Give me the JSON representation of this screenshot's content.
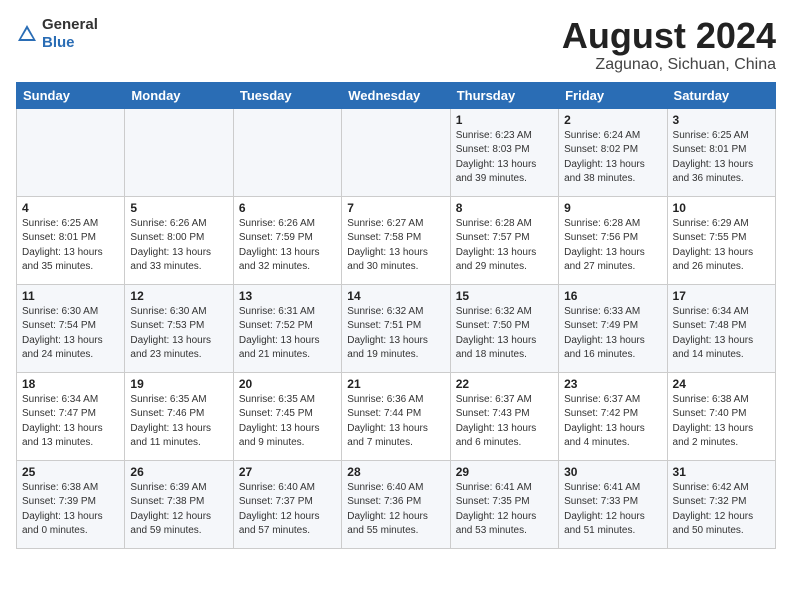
{
  "header": {
    "logo_general": "General",
    "logo_blue": "Blue",
    "month_title": "August 2024",
    "location": "Zagunao, Sichuan, China"
  },
  "weekdays": [
    "Sunday",
    "Monday",
    "Tuesday",
    "Wednesday",
    "Thursday",
    "Friday",
    "Saturday"
  ],
  "weeks": [
    [
      {
        "day": "",
        "info": ""
      },
      {
        "day": "",
        "info": ""
      },
      {
        "day": "",
        "info": ""
      },
      {
        "day": "",
        "info": ""
      },
      {
        "day": "1",
        "info": "Sunrise: 6:23 AM\nSunset: 8:03 PM\nDaylight: 13 hours\nand 39 minutes."
      },
      {
        "day": "2",
        "info": "Sunrise: 6:24 AM\nSunset: 8:02 PM\nDaylight: 13 hours\nand 38 minutes."
      },
      {
        "day": "3",
        "info": "Sunrise: 6:25 AM\nSunset: 8:01 PM\nDaylight: 13 hours\nand 36 minutes."
      }
    ],
    [
      {
        "day": "4",
        "info": "Sunrise: 6:25 AM\nSunset: 8:01 PM\nDaylight: 13 hours\nand 35 minutes."
      },
      {
        "day": "5",
        "info": "Sunrise: 6:26 AM\nSunset: 8:00 PM\nDaylight: 13 hours\nand 33 minutes."
      },
      {
        "day": "6",
        "info": "Sunrise: 6:26 AM\nSunset: 7:59 PM\nDaylight: 13 hours\nand 32 minutes."
      },
      {
        "day": "7",
        "info": "Sunrise: 6:27 AM\nSunset: 7:58 PM\nDaylight: 13 hours\nand 30 minutes."
      },
      {
        "day": "8",
        "info": "Sunrise: 6:28 AM\nSunset: 7:57 PM\nDaylight: 13 hours\nand 29 minutes."
      },
      {
        "day": "9",
        "info": "Sunrise: 6:28 AM\nSunset: 7:56 PM\nDaylight: 13 hours\nand 27 minutes."
      },
      {
        "day": "10",
        "info": "Sunrise: 6:29 AM\nSunset: 7:55 PM\nDaylight: 13 hours\nand 26 minutes."
      }
    ],
    [
      {
        "day": "11",
        "info": "Sunrise: 6:30 AM\nSunset: 7:54 PM\nDaylight: 13 hours\nand 24 minutes."
      },
      {
        "day": "12",
        "info": "Sunrise: 6:30 AM\nSunset: 7:53 PM\nDaylight: 13 hours\nand 23 minutes."
      },
      {
        "day": "13",
        "info": "Sunrise: 6:31 AM\nSunset: 7:52 PM\nDaylight: 13 hours\nand 21 minutes."
      },
      {
        "day": "14",
        "info": "Sunrise: 6:32 AM\nSunset: 7:51 PM\nDaylight: 13 hours\nand 19 minutes."
      },
      {
        "day": "15",
        "info": "Sunrise: 6:32 AM\nSunset: 7:50 PM\nDaylight: 13 hours\nand 18 minutes."
      },
      {
        "day": "16",
        "info": "Sunrise: 6:33 AM\nSunset: 7:49 PM\nDaylight: 13 hours\nand 16 minutes."
      },
      {
        "day": "17",
        "info": "Sunrise: 6:34 AM\nSunset: 7:48 PM\nDaylight: 13 hours\nand 14 minutes."
      }
    ],
    [
      {
        "day": "18",
        "info": "Sunrise: 6:34 AM\nSunset: 7:47 PM\nDaylight: 13 hours\nand 13 minutes."
      },
      {
        "day": "19",
        "info": "Sunrise: 6:35 AM\nSunset: 7:46 PM\nDaylight: 13 hours\nand 11 minutes."
      },
      {
        "day": "20",
        "info": "Sunrise: 6:35 AM\nSunset: 7:45 PM\nDaylight: 13 hours\nand 9 minutes."
      },
      {
        "day": "21",
        "info": "Sunrise: 6:36 AM\nSunset: 7:44 PM\nDaylight: 13 hours\nand 7 minutes."
      },
      {
        "day": "22",
        "info": "Sunrise: 6:37 AM\nSunset: 7:43 PM\nDaylight: 13 hours\nand 6 minutes."
      },
      {
        "day": "23",
        "info": "Sunrise: 6:37 AM\nSunset: 7:42 PM\nDaylight: 13 hours\nand 4 minutes."
      },
      {
        "day": "24",
        "info": "Sunrise: 6:38 AM\nSunset: 7:40 PM\nDaylight: 13 hours\nand 2 minutes."
      }
    ],
    [
      {
        "day": "25",
        "info": "Sunrise: 6:38 AM\nSunset: 7:39 PM\nDaylight: 13 hours\nand 0 minutes."
      },
      {
        "day": "26",
        "info": "Sunrise: 6:39 AM\nSunset: 7:38 PM\nDaylight: 12 hours\nand 59 minutes."
      },
      {
        "day": "27",
        "info": "Sunrise: 6:40 AM\nSunset: 7:37 PM\nDaylight: 12 hours\nand 57 minutes."
      },
      {
        "day": "28",
        "info": "Sunrise: 6:40 AM\nSunset: 7:36 PM\nDaylight: 12 hours\nand 55 minutes."
      },
      {
        "day": "29",
        "info": "Sunrise: 6:41 AM\nSunset: 7:35 PM\nDaylight: 12 hours\nand 53 minutes."
      },
      {
        "day": "30",
        "info": "Sunrise: 6:41 AM\nSunset: 7:33 PM\nDaylight: 12 hours\nand 51 minutes."
      },
      {
        "day": "31",
        "info": "Sunrise: 6:42 AM\nSunset: 7:32 PM\nDaylight: 12 hours\nand 50 minutes."
      }
    ]
  ]
}
